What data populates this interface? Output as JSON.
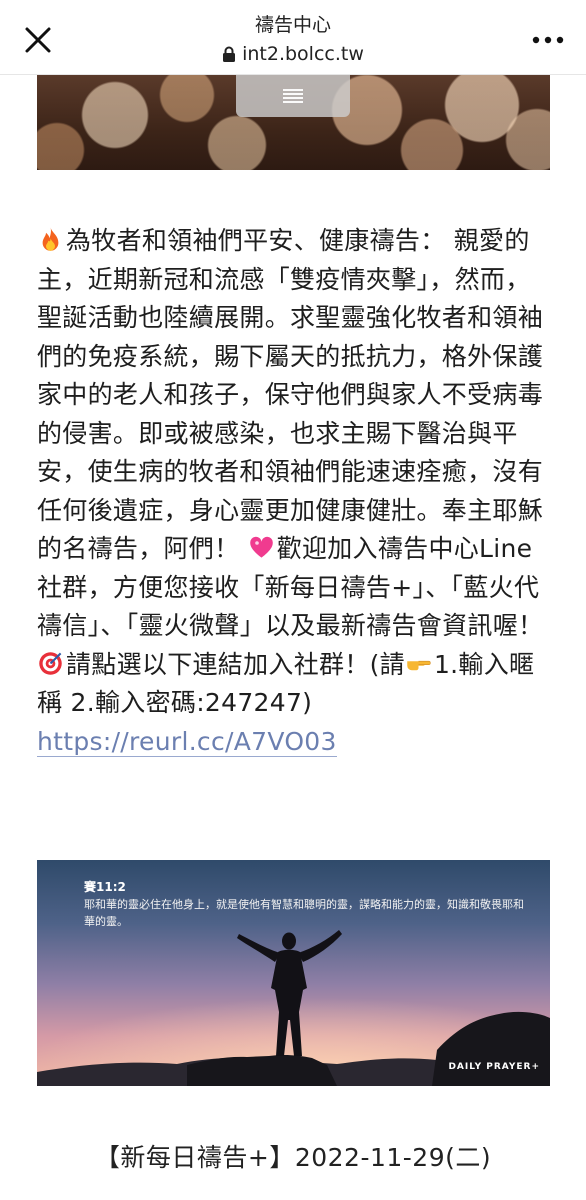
{
  "browser": {
    "page_title": "禱告中心",
    "url": "int2.bolcc.tw",
    "close_icon": "close-icon",
    "more_icon": "more-horizontal-icon",
    "lock_icon": "lock-icon"
  },
  "top_banner": {
    "menu_icon": "hamburger-menu-icon"
  },
  "article": {
    "fire_emoji": "fire-emoji-icon",
    "heart_emoji": "sparkling-heart-emoji-icon",
    "target_emoji": "bullseye-emoji-icon",
    "pointing_emoji": "pointing-right-emoji-icon",
    "text_1": "為牧者和領袖們平安、健康禱告： 親愛的主，近期新冠和流感「雙疫情夾擊」，然而，聖誕活動也陸續展開。求聖靈強化牧者和領袖們的免疫系統，賜下屬天的抵抗力，格外保護家中的老人和孩子，保守他們與家人不受病毒的侵害。即或被感染，也求主賜下醫治與平安，使生病的牧者和領袖們能速速痊癒，沒有任何後遺症，身心靈更加健康健壯。奉主耶穌的名禱告，阿們！",
    "text_2": "歡迎加入禱告中心Line社群，方便您接收「新每日禱告+」、「藍火代禱信」、「靈火微聲」以及最新禱告會資訊喔！",
    "text_3": "請點選以下連結加入社群！(請",
    "text_4": "1.輸入暱稱 2.輸入密碼:247247)",
    "link": "https://reurl.cc/A7VO03"
  },
  "bottom_banner": {
    "verse_ref": "賽11:2",
    "verse_text": "耶和華的靈必住在他身上，就是使他有智慧和聰明的靈，謀略和能力的靈，知識和敬畏耶和華的靈。",
    "brand": "DAILY PRAYER+"
  },
  "post": {
    "title": "【新每日禱告+】2022-11-29(二)"
  },
  "colors": {
    "link": "#6b7fb0",
    "text": "#1e1e1e"
  }
}
